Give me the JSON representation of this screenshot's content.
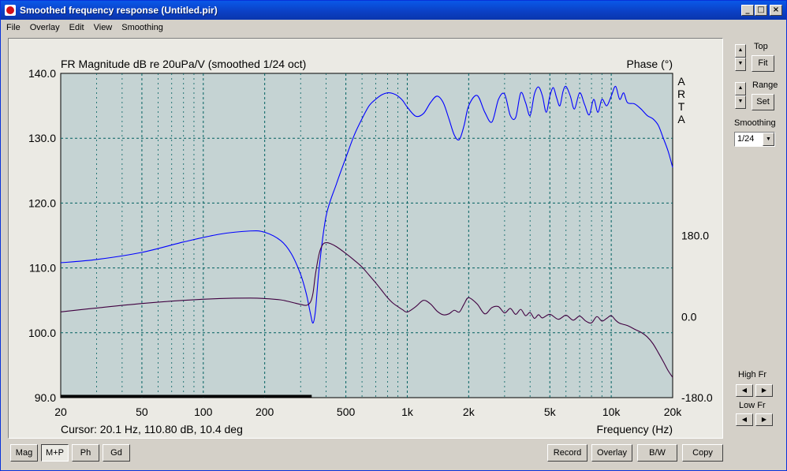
{
  "window": {
    "title": "Smoothed frequency response (Untitled.pir)"
  },
  "menu": [
    "File",
    "Overlay",
    "Edit",
    "View",
    "Smoothing"
  ],
  "plot": {
    "cursor_text": "Cursor: 20.1 Hz, 110.80 dB, 10.4 deg",
    "brand": "ARTA"
  },
  "right_panel": {
    "top_label": "Top",
    "fit_label": "Fit",
    "range_label": "Range",
    "set_label": "Set",
    "smoothing_label": "Smoothing",
    "smoothing_value": "1/24",
    "high_fr_label": "High Fr",
    "low_fr_label": "Low Fr"
  },
  "bottom_left_buttons": [
    "Mag",
    "M+P",
    "Ph",
    "Gd"
  ],
  "bottom_left_active": "M+P",
  "bottom_right_buttons": [
    "Record",
    "Overlay",
    "B/W",
    "Copy"
  ],
  "colors": {
    "plot_bg": "#c5d3d3",
    "magnitude": "#0000ff",
    "phase": "#400040",
    "grid": "#006060"
  },
  "chart_data": {
    "type": "line",
    "title": "FR Magnitude dB re 20uPa/V (smoothed 1/24 oct)",
    "title_right": "Phase (°)",
    "xlabel": "Frequency (Hz)",
    "x_scale": "log",
    "xlim": [
      20,
      20000
    ],
    "ylim": [
      90,
      140
    ],
    "y2lim": [
      -180,
      540
    ],
    "x_ticks": [
      {
        "v": 20,
        "label": "20"
      },
      {
        "v": 50,
        "label": "50"
      },
      {
        "v": 100,
        "label": "100"
      },
      {
        "v": 200,
        "label": "200"
      },
      {
        "v": 500,
        "label": "500"
      },
      {
        "v": 1000,
        "label": "1k"
      },
      {
        "v": 2000,
        "label": "2k"
      },
      {
        "v": 5000,
        "label": "5k"
      },
      {
        "v": 10000,
        "label": "10k"
      },
      {
        "v": 20000,
        "label": "20k"
      }
    ],
    "y_ticks": [
      "90.0",
      "100.0",
      "110.0",
      "120.0",
      "130.0",
      "140.0"
    ],
    "y2_ticks": [
      {
        "v": 180,
        "label": "180.0"
      },
      {
        "v": 0,
        "label": "0.0"
      },
      {
        "v": -180,
        "label": "-180.0"
      }
    ],
    "grid": true,
    "series": [
      {
        "color": "#0000ff",
        "axis": "left",
        "x": [
          20,
          30,
          50,
          80,
          120,
          170,
          200,
          240,
          270,
          300,
          320,
          335,
          345,
          355,
          370,
          400,
          450,
          500,
          550,
          600,
          650,
          700,
          750,
          800,
          850,
          900,
          950,
          1000,
          1100,
          1200,
          1300,
          1400,
          1500,
          1600,
          1700,
          1800,
          1900,
          2000,
          2200,
          2400,
          2600,
          2800,
          3000,
          3200,
          3400,
          3600,
          3800,
          4000,
          4200,
          4400,
          4600,
          4800,
          5000,
          5200,
          5400,
          5600,
          5800,
          6000,
          6300,
          6600,
          7000,
          7400,
          7800,
          8200,
          8600,
          9000,
          9500,
          10000,
          10500,
          11000,
          11500,
          12000,
          13000,
          14000,
          15000,
          16000,
          17000,
          18000,
          19000,
          20000
        ],
        "y": [
          110.8,
          111.3,
          112.4,
          114.0,
          115.2,
          115.7,
          115.5,
          114.2,
          112.2,
          109.0,
          106.0,
          103.0,
          101.5,
          103.5,
          110.0,
          118.0,
          123.0,
          127.0,
          130.5,
          133.0,
          135.0,
          136.0,
          136.7,
          137.0,
          136.9,
          136.5,
          135.8,
          134.8,
          133.4,
          133.8,
          135.5,
          136.5,
          135.5,
          133.0,
          130.5,
          129.8,
          132.0,
          135.0,
          136.6,
          134.0,
          132.5,
          136.0,
          136.8,
          133.5,
          133.2,
          137.0,
          135.5,
          133.5,
          136.8,
          137.9,
          136.5,
          134.0,
          136.5,
          137.8,
          136.2,
          135.0,
          137.2,
          138.0,
          136.5,
          134.5,
          137.0,
          135.2,
          133.6,
          136.0,
          134.0,
          136.0,
          135.0,
          136.5,
          138.0,
          136.0,
          137.0,
          135.5,
          135.3,
          134.5,
          133.5,
          133.0,
          132.0,
          130.0,
          128.0,
          125.5
        ],
        "name": ""
      },
      {
        "color": "#400040",
        "axis": "right",
        "x": [
          20,
          30,
          50,
          80,
          120,
          170,
          200,
          240,
          270,
          300,
          320,
          335,
          345,
          355,
          370,
          385,
          400,
          420,
          450,
          500,
          550,
          600,
          650,
          700,
          750,
          800,
          850,
          900,
          950,
          1000,
          1100,
          1200,
          1300,
          1400,
          1500,
          1600,
          1700,
          1800,
          1900,
          2000,
          2200,
          2400,
          2600,
          2800,
          3000,
          3200,
          3400,
          3600,
          3800,
          4000,
          4200,
          4400,
          4600,
          5000,
          5500,
          6000,
          6500,
          7000,
          7500,
          8000,
          8500,
          9000,
          9500,
          10000,
          10500,
          11000,
          12000,
          13000,
          14000,
          15000,
          16000,
          17000,
          18000,
          19000,
          20000
        ],
        "y": [
          10.4,
          19,
          29,
          36,
          40,
          41,
          40,
          37,
          32,
          27,
          25,
          32,
          52,
          95,
          140,
          160,
          164,
          162,
          155,
          140,
          125,
          110,
          92,
          75,
          58,
          42,
          30,
          22,
          15,
          10,
          22,
          36,
          28,
          12,
          4,
          6,
          14,
          10,
          28,
          42,
          28,
          6,
          20,
          22,
          8,
          18,
          5,
          16,
          2,
          9,
          -4,
          4,
          -3,
          5,
          -6,
          3,
          -8,
          1,
          -10,
          -14,
          0,
          -10,
          -4,
          2,
          -8,
          -15,
          -20,
          -28,
          -35,
          -45,
          -60,
          -80,
          -100,
          -120,
          -135
        ],
        "name": ""
      }
    ],
    "annotations": [
      {
        "type": "hline",
        "axis": "left",
        "y": 90,
        "x_from": 20,
        "x_to": 340,
        "color": "#000000"
      }
    ]
  }
}
